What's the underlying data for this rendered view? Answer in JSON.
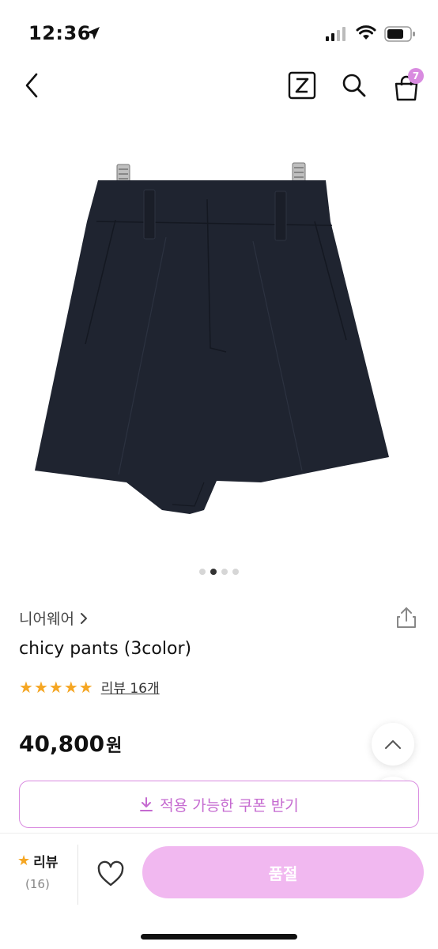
{
  "status": {
    "time": "12:36"
  },
  "nav": {
    "cart_count": "7",
    "z_label": "Z"
  },
  "product": {
    "brand": "니어웨어",
    "name": "chicy pants (3color)",
    "rating_stars": 5,
    "review_link": "리뷰 16개",
    "price": "40,800",
    "price_unit": "원",
    "image_count": 4,
    "image_index": 1
  },
  "coupon": {
    "label": "적용 가능한 쿠폰 받기"
  },
  "bottom": {
    "review_label": "리뷰",
    "review_count": "(16)",
    "soldout_label": "품절"
  },
  "colors": {
    "accent": "#d98be0",
    "soldout_bg": "#f1b8f0",
    "star": "#f5a623",
    "garment": "#1f2430"
  }
}
